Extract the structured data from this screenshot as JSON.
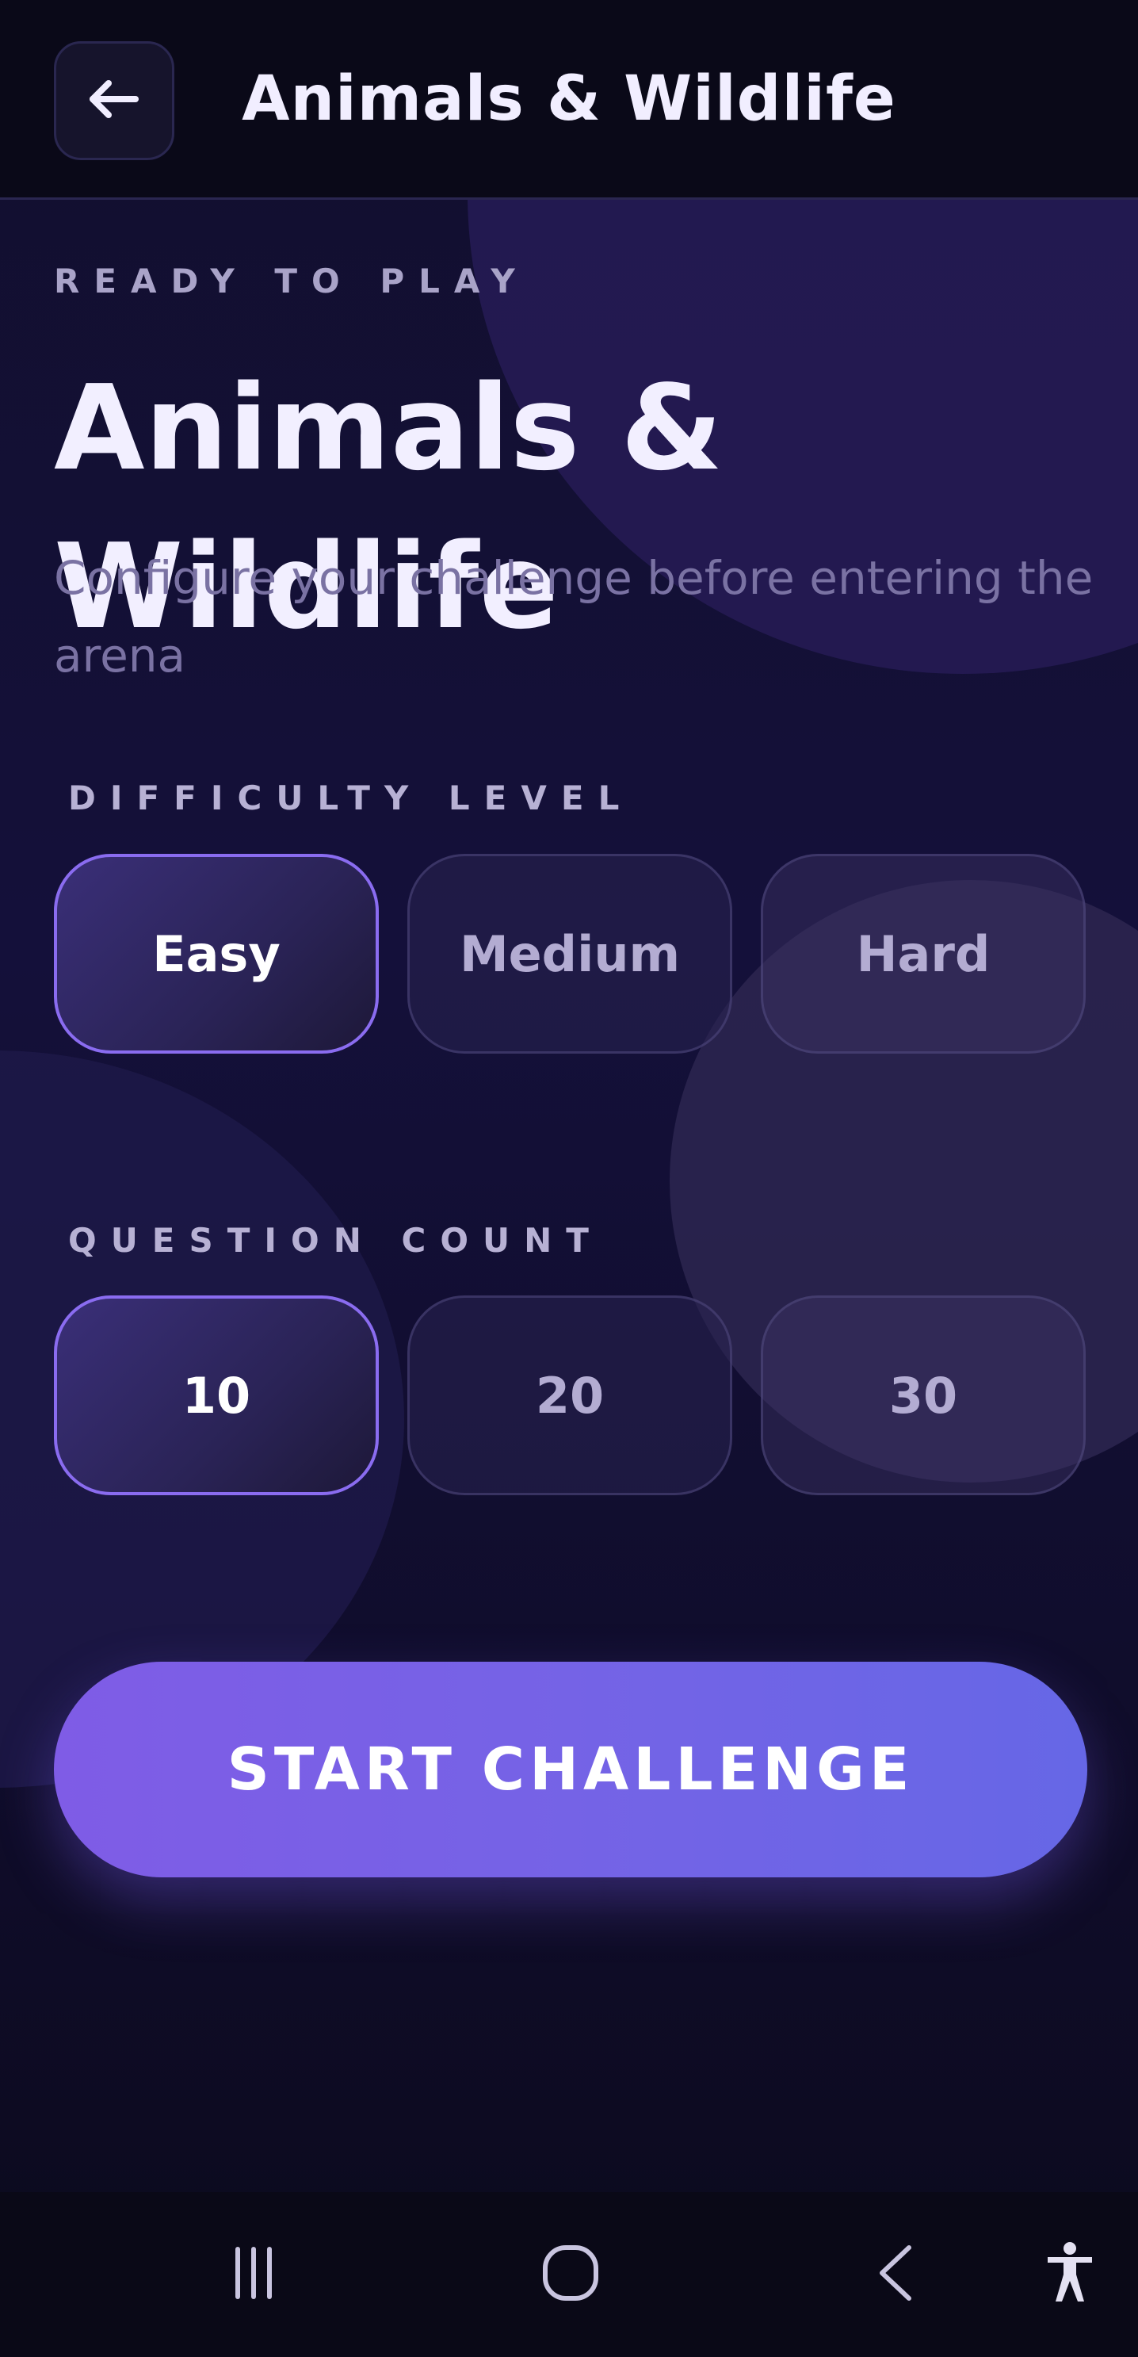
{
  "header": {
    "back_icon": "arrow-left-icon",
    "title": "Animals & Wildlife"
  },
  "hero": {
    "eyebrow": "READY TO PLAY",
    "title": "Animals & Wildlife",
    "subtitle": "Configure your challenge before entering the arena"
  },
  "difficulty": {
    "label": "DIFFICULTY LEVEL",
    "options": [
      "Easy",
      "Medium",
      "Hard"
    ],
    "selected": "Easy"
  },
  "question_count": {
    "label": "QUESTION COUNT",
    "options": [
      "10",
      "20",
      "30"
    ],
    "selected": "10"
  },
  "cta": {
    "label": "START CHALLENGE"
  },
  "colors": {
    "accent": "#8a6cf0",
    "cta_start": "#7f5ce6",
    "cta_end": "#6667e6",
    "background": "#120f2e"
  },
  "system_nav": {
    "recents_icon": "recents-icon",
    "home_icon": "home-icon",
    "back_icon": "chevron-left-icon",
    "accessibility_icon": "accessibility-icon"
  }
}
